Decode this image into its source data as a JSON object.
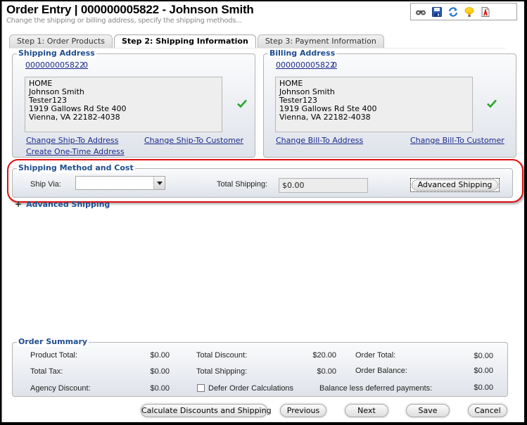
{
  "header": {
    "title": "Order Entry | 000000005822 - Johnson Smith",
    "subtitle": "Change the shipping or billing address, specify the shipping methods..."
  },
  "toolbar": {
    "icons": [
      "binoculars-icon",
      "save-disk-icon",
      "refresh-icon",
      "lightbulb-icon",
      "report-icon"
    ]
  },
  "tabs": [
    {
      "label": "Step 1: Order Products",
      "active": false
    },
    {
      "label": "Step 2: Shipping Information",
      "active": true
    },
    {
      "label": "Step 3: Payment Information",
      "active": false
    }
  ],
  "shipping_address": {
    "legend": "Shipping Address",
    "customer_id": "000000005822",
    "address_id": "0",
    "lines": [
      "HOME",
      "Johnson Smith",
      "Tester123",
      "1919 Gallows Rd Ste 400",
      "Vienna, VA 22182-4038"
    ],
    "links": {
      "change_address": "Change Ship-To Address",
      "change_customer": "Change Ship-To Customer",
      "one_time": "Create One-Time Address"
    }
  },
  "billing_address": {
    "legend": "Billing Address",
    "customer_id": "000000005822",
    "address_id": "0",
    "lines": [
      "HOME",
      "Johnson Smith",
      "Tester123",
      "1919 Gallows Rd Ste 400",
      "Vienna, VA 22182-4038"
    ],
    "links": {
      "change_address": "Change Bill-To Address",
      "change_customer": "Change Bill-To Customer"
    }
  },
  "shipping_method": {
    "legend": "Shipping Method and Cost",
    "ship_via_label": "Ship Via:",
    "ship_via_value": "",
    "total_shipping_label": "Total Shipping:",
    "total_shipping_value": "$0.00",
    "advanced_button": "Advanced Shipping"
  },
  "advanced_section": {
    "toggle": "+",
    "label": "Advanced Shipping"
  },
  "order_summary": {
    "legend": "Order Summary",
    "product_total_label": "Product Total:",
    "product_total": "$0.00",
    "total_tax_label": "Total Tax:",
    "total_tax": "$0.00",
    "agency_discount_label": "Agency Discount:",
    "agency_discount": "$0.00",
    "total_discount_label": "Total Discount:",
    "total_discount": "$20.00",
    "total_shipping_label": "Total Shipping:",
    "total_shipping": "$0.00",
    "defer_label": "Defer Order Calculations",
    "defer_checked": false,
    "order_total_label": "Order Total:",
    "order_total": "$0.00",
    "order_balance_label": "Order Balance:",
    "order_balance": "$0.00",
    "balance_less_label": "Balance less deferred payments:",
    "balance_less": "$0.00"
  },
  "buttons": {
    "calculate": "Calculate Discounts and Shipping",
    "previous": "Previous",
    "next": "Next",
    "save": "Save",
    "cancel": "Cancel"
  },
  "colors": {
    "legend": "#1e4c8f",
    "link": "#1a2a8a",
    "highlight_ring": "#e01010",
    "check": "#2aa52a"
  }
}
